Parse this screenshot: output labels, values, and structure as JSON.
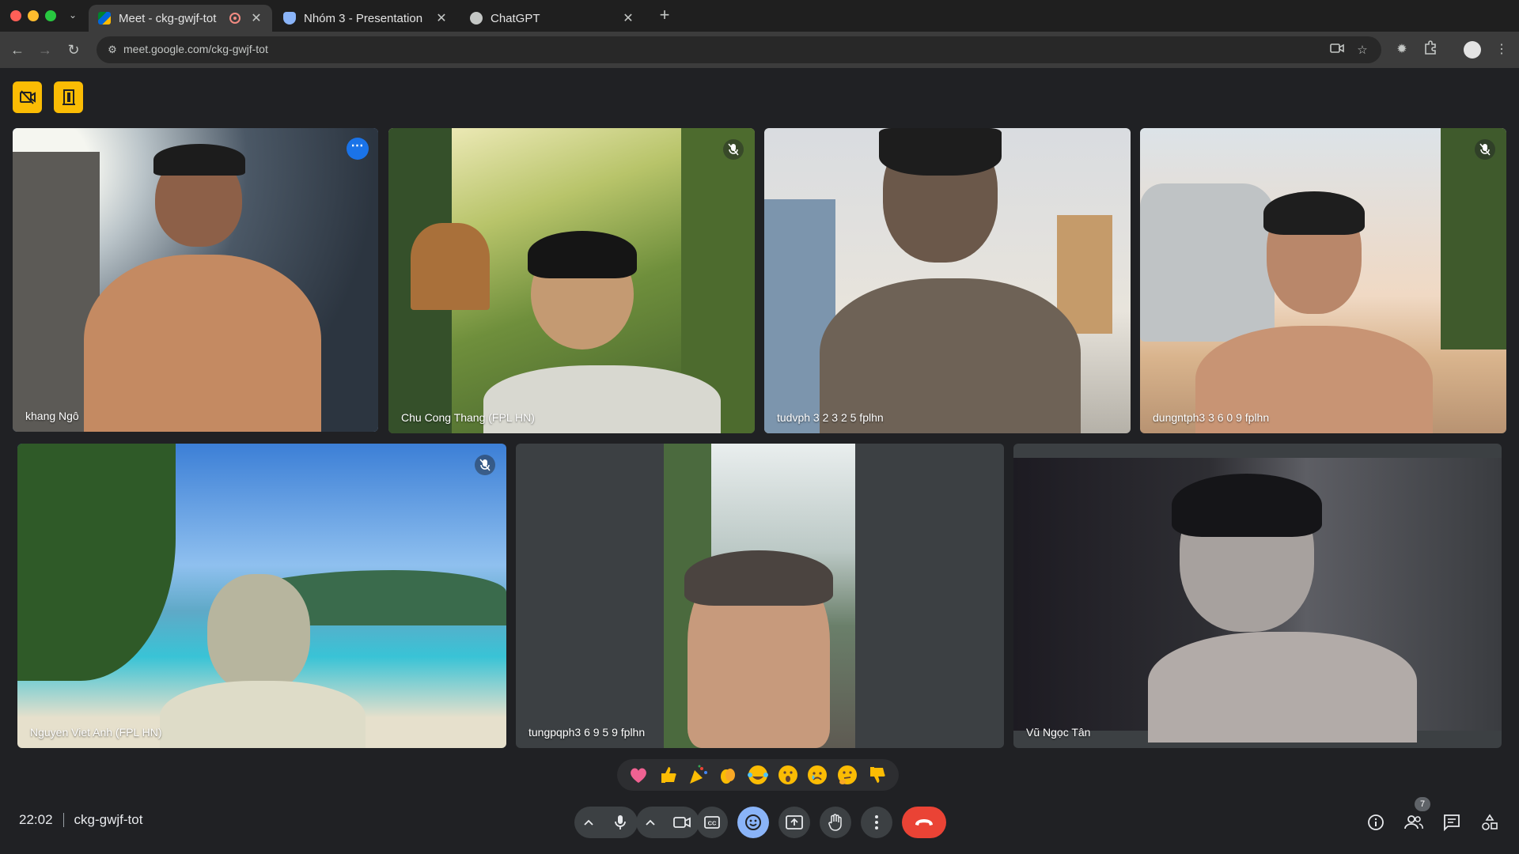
{
  "browser": {
    "tabs": [
      {
        "title": "Meet - ckg-gwjf-tot",
        "active": true,
        "recording": true,
        "favicon": "meet-icon"
      },
      {
        "title": "Nhóm 3 - Presentation",
        "active": false,
        "favicon": "shield-icon"
      },
      {
        "title": "ChatGPT",
        "active": false,
        "favicon": "chatgpt-icon"
      }
    ],
    "url": "meet.google.com/ckg-gwjf-tot"
  },
  "meeting": {
    "time": "22:02",
    "code": "ckg-gwjf-tot",
    "participant_count": "7"
  },
  "participants": [
    {
      "name": "khang Ngô",
      "speaking": true,
      "muted": false
    },
    {
      "name": "Chu Cong Thang (FPL HN)",
      "muted": true
    },
    {
      "name": "tudvph 3 2 3 2 5 fplhn",
      "muted": false
    },
    {
      "name": "dungntph3 3 6 0 9 fplhn",
      "muted": true
    },
    {
      "name": "Nguyen Viet Anh (FPL HN)",
      "muted": true
    },
    {
      "name": "tungpqph3 6 9 5 9 fplhn",
      "muted": false
    },
    {
      "name": "Vũ Ngọc Tân",
      "muted": false
    }
  ],
  "reactions": [
    "sparkling-heart",
    "thumbs-up",
    "party-popper",
    "clapping-hands",
    "tears-of-joy",
    "surprised-face",
    "crying-face",
    "thinking-face",
    "thumbs-down"
  ],
  "colors": {
    "background": "#202124",
    "accent": "#8ab4f8",
    "hangup": "#ea4335",
    "badge": "#fbbc04",
    "control": "#3c4043"
  }
}
